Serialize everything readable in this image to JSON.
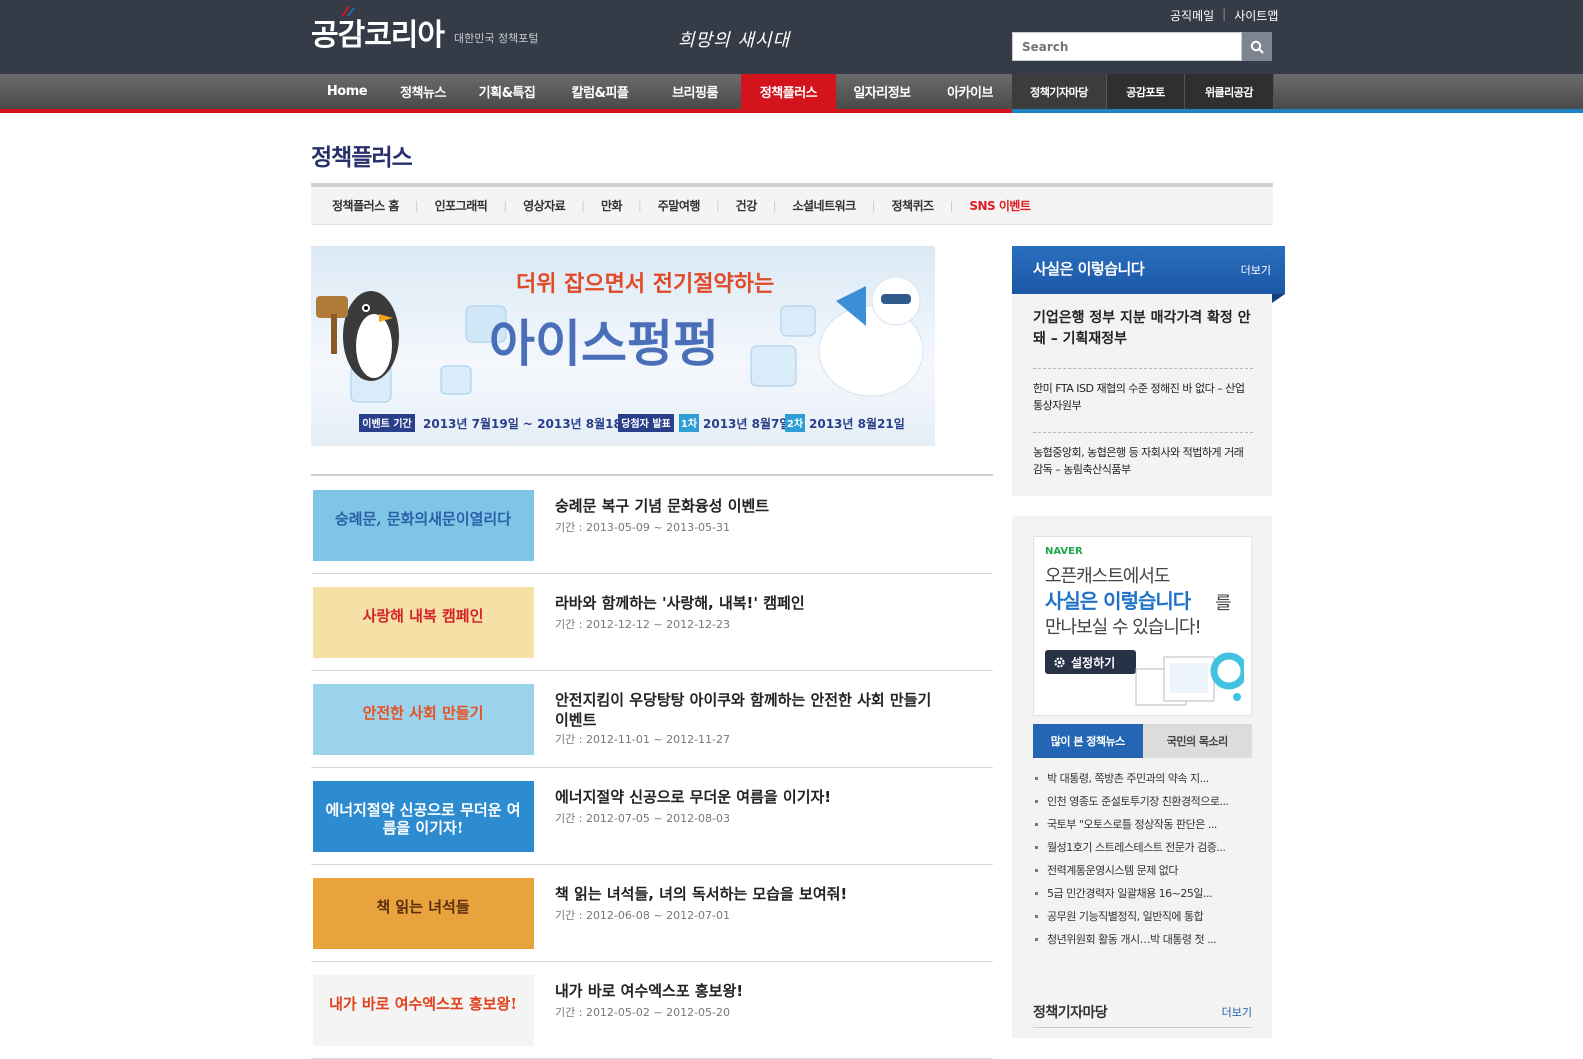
{
  "header": {
    "logo_text": "공감코리아",
    "logo_sub": "대한민국 정책포털",
    "slogan": "희망의 새시대",
    "links": [
      "공직메일",
      "사이트맵"
    ],
    "search_placeholder": "Search"
  },
  "nav": {
    "items": [
      "Home",
      "정책뉴스",
      "기획&특집",
      "칼럼&피플",
      "브리핑룸",
      "정책플러스",
      "일자리정보",
      "아카이브"
    ],
    "active": "정책플러스",
    "right_items": [
      "정책기자마당",
      "공감포토",
      "위클리공감"
    ]
  },
  "page_title": "정책플러스",
  "subnav": [
    "정책플러스 홈",
    "인포그래픽",
    "영상자료",
    "만화",
    "주말여행",
    "건강",
    "소셜네트워크",
    "정책퀴즈",
    "SNS 이벤트"
  ],
  "banner": {
    "headline": "더위 잡으면서 전기절약하는",
    "title": "아이스펑펑",
    "event_label": "이벤트 기간",
    "event_period": "2013년 7월19일 ~ 2013년 8월18일",
    "winner_label": "당첨자 발표",
    "first_label": "1차",
    "first_date": "2013년 8월7일",
    "second_label": "2차",
    "second_date": "2013년 8월21일"
  },
  "events": [
    {
      "title": "숭례문 복구 기념 문화융성 이벤트",
      "period": "기간 : 2013-05-09 ~ 2013-05-31",
      "thumb_text": "숭례문, 문화의새문이열리다",
      "thumb_bg": "#7fc6e6",
      "thumb_fg": "#2b5fa8"
    },
    {
      "title": "라바와 함께하는 '사랑해, 내복!' 캠페인",
      "period": "기간 : 2012-12-12 ~ 2012-12-23",
      "thumb_text": "사랑해 내복 캠페인",
      "thumb_bg": "#f5e1a6",
      "thumb_fg": "#d4222a"
    },
    {
      "title": "안전지킴이 우당탕탕 아이쿠와 함께하는 안전한 사회 만들기 이벤트",
      "period": "기간 : 2012-11-01 ~ 2012-11-27",
      "thumb_text": "안전한 사회 만들기",
      "thumb_bg": "#9bd3ec",
      "thumb_fg": "#e8511e"
    },
    {
      "title": "에너지절약 신공으로 무더운 여름을 이기자!",
      "period": "기간 : 2012-07-05 ~ 2012-08-03",
      "thumb_text": "에너지절약 신공으로 무더운 여름을 이기자!",
      "thumb_bg": "#2d8bd0",
      "thumb_fg": "#ffffff"
    },
    {
      "title": "책 읽는 녀석들, 녀의 독서하는 모습을 보여줘!",
      "period": "기간 : 2012-06-08 ~ 2012-07-01",
      "thumb_text": "책 읽는 녀석들",
      "thumb_bg": "#e9a33d",
      "thumb_fg": "#5a2d0c"
    },
    {
      "title": "내가 바로 여수엑스포 홍보왕!",
      "period": "기간 : 2012-05-02 ~ 2012-05-20",
      "thumb_text": "내가 바로 여수엑스포 홍보왕!",
      "thumb_bg": "#f4f4f4",
      "thumb_fg": "#e0401a"
    }
  ],
  "fact_box": {
    "title": "사실은 이렇습니다",
    "more": "더보기",
    "items": [
      "기업은행 정부 지분 매각가격 확정 안돼 – 기획재정부",
      "한미 FTA ISD 재협의 수준 정해진 바 없다 – 산업통상자원부",
      "농협중앙회, 농협은행 등 자회사와 적법하게 거래 감독 – 농림축산식품부"
    ]
  },
  "promo": {
    "brand": "NAVER",
    "line1": "오픈캐스트에서도",
    "line2": "사실은 이렇습니다",
    "line2_suffix": "를",
    "line3": "만나보실 수 있습니다!",
    "button": "설정하기"
  },
  "tabs": [
    "많이 본 정책뉴스",
    "국민의 목소리"
  ],
  "popular_news": [
    "박 대통령, 쪽방촌 주민과의 약속 지...",
    "인천 영종도 준설토투기장 친환경적으로...",
    "국토부 \"오토스로틀 정상작동 판단은 ...",
    "월성1호기 스트레스테스트 전문가 검증...",
    "전력계통운영시스템 문제 없다",
    "5급 민간경력자 일괄채용 16~25일...",
    "공무원 기능직별정직, 일반직에 통합",
    "청년위원회 활동 개시…박 대통령 첫 ..."
  ],
  "reporter": {
    "title": "정책기자마당",
    "more": "더보기"
  },
  "colors": {
    "header_bg": "#353c47",
    "active_red": "#d4141d",
    "accent_blue": "#1f5fae",
    "title_navy": "#27306b"
  }
}
